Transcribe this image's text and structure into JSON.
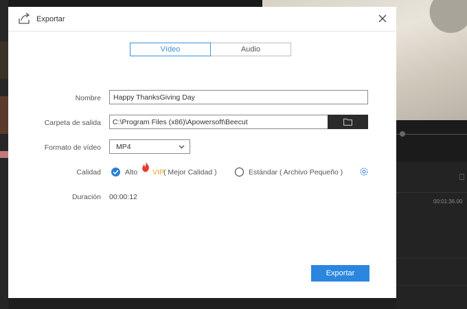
{
  "background": {
    "timeline_time": "00:01:36.00"
  },
  "dialog": {
    "title": "Exportar",
    "tabs": [
      {
        "label": "Vídeo",
        "active": true
      },
      {
        "label": "Audio",
        "active": false
      }
    ],
    "fields": {
      "name_label": "Nombre",
      "name_value": "Happy ThanksGiving Day",
      "folder_label": "Carpeta de salida",
      "folder_value": "C:\\Program Files (x86)\\Apowersoft\\Beecut",
      "format_label": "Formato de vídeo",
      "format_value": "MP4",
      "quality_label": "Calidad",
      "quality_high_label": "Alto",
      "quality_vip_badge": "VIP",
      "quality_high_note": "( Mejor Calidad )",
      "quality_standard_label": "Estándar ( Archivo Pequeño )",
      "quality_selected": "Alto",
      "duration_label": "Duración",
      "duration_value": "00:00:12"
    },
    "export_label": "Exportar"
  },
  "colors": {
    "accent": "#2b86e0",
    "tab_active": "#3a8fd9",
    "vip": "#e6a417",
    "flame": "#e53b2e",
    "folder_button": "#2b2b2b"
  },
  "icons": [
    "export-icon",
    "close-icon",
    "folder-icon",
    "chevron-down-icon",
    "checkmark-icon",
    "flame-icon",
    "settings-icon"
  ]
}
